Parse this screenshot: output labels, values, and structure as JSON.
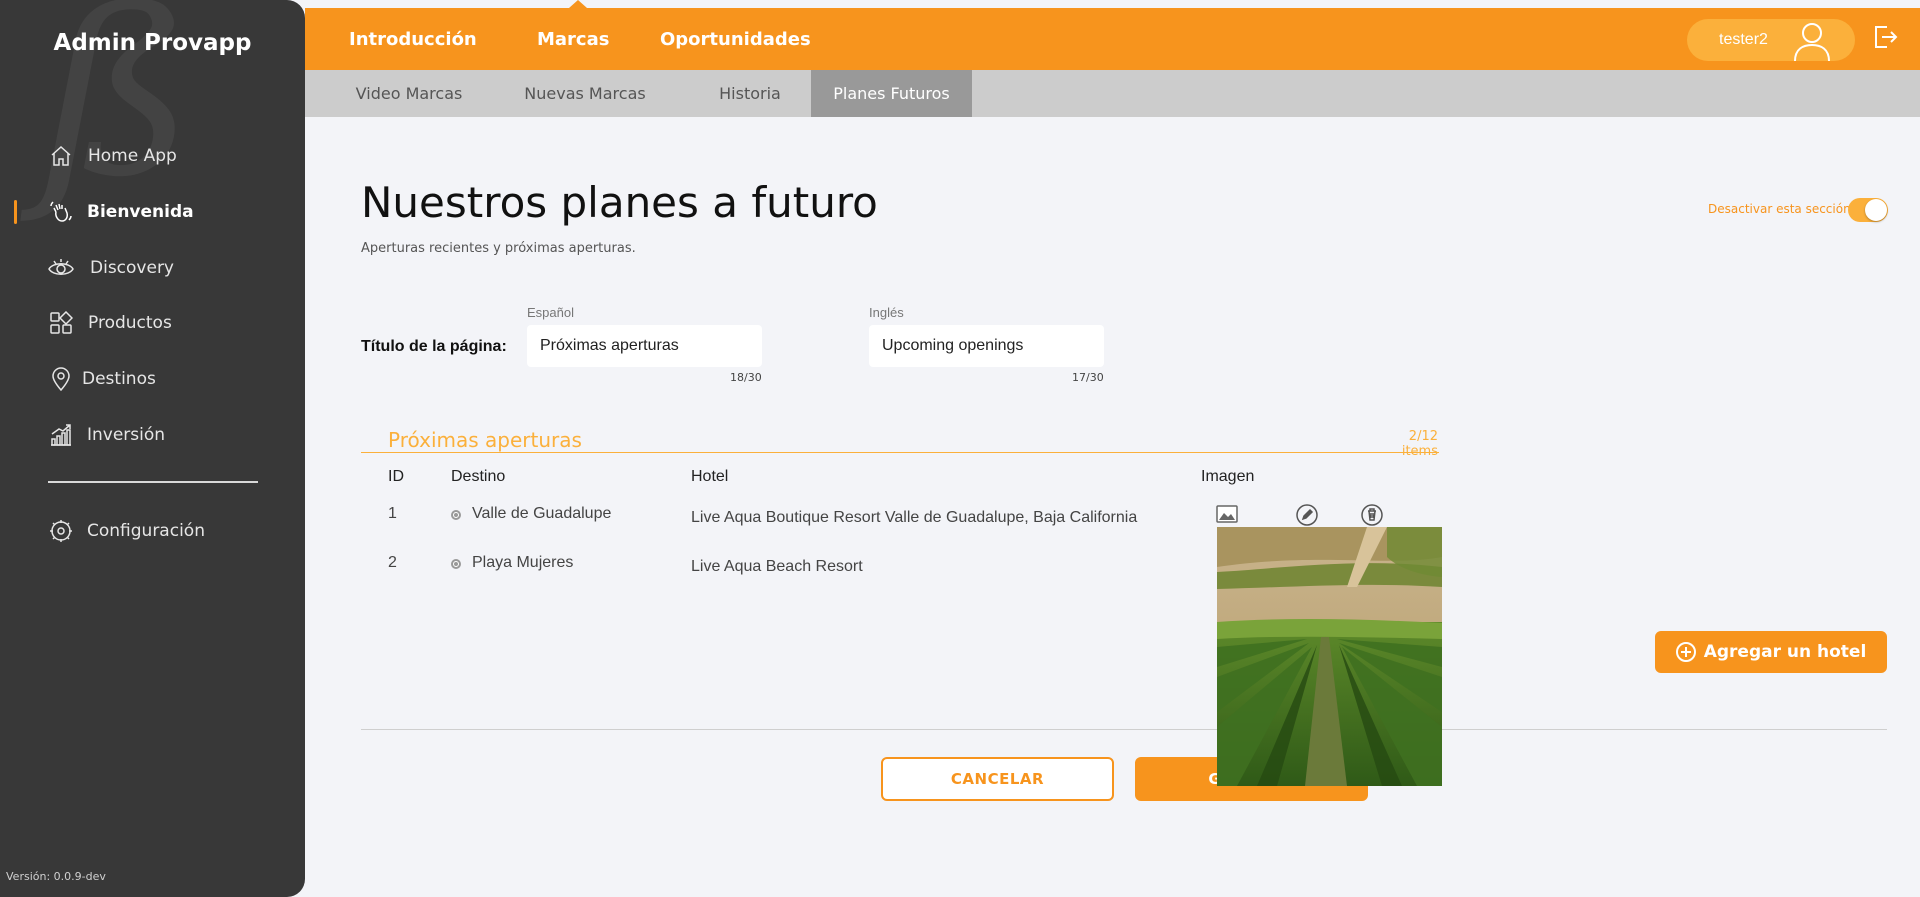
{
  "app": {
    "brand": "Admin Provapp",
    "version": "Versión: 0.0.9-dev"
  },
  "sidebar": {
    "items": [
      {
        "label": "Home App",
        "icon": "home-icon"
      },
      {
        "label": "Bienvenida",
        "icon": "waving-hand-icon",
        "active": true
      },
      {
        "label": "Discovery",
        "icon": "eye-icon"
      },
      {
        "label": "Productos",
        "icon": "grid-shapes-icon"
      },
      {
        "label": "Destinos",
        "icon": "map-pin-icon"
      },
      {
        "label": "Inversión",
        "icon": "growth-chart-icon"
      }
    ],
    "settings": {
      "label": "Configuración",
      "icon": "gear-icon"
    }
  },
  "topnav": {
    "tabs": [
      {
        "label": "Introducción"
      },
      {
        "label": "Marcas",
        "active": true
      },
      {
        "label": "Oportunidades"
      }
    ],
    "user": "tester2"
  },
  "subnav": {
    "tabs": [
      {
        "label": "Video Marcas"
      },
      {
        "label": "Nuevas Marcas"
      },
      {
        "label": "Historia"
      },
      {
        "label": "Planes Futuros",
        "active": true
      }
    ]
  },
  "page": {
    "title": "Nuestros planes a futuro",
    "subtitle": "Aperturas recientes y próximas aperturas.",
    "toggle_label": "Desactivar esta sección",
    "toggle_on": true
  },
  "form": {
    "field_label": "Título de la página:",
    "spanish": {
      "label": "Español",
      "value": "Próximas aperturas",
      "counter": "18/30"
    },
    "english": {
      "label": "Inglés",
      "value": "Upcoming openings",
      "counter": "17/30"
    }
  },
  "section": {
    "title": "Próximas aperturas",
    "count": "2/12 items",
    "columns": {
      "id": "ID",
      "destino": "Destino",
      "hotel": "Hotel",
      "imagen": "Imagen"
    },
    "rows": [
      {
        "id": "1",
        "destino": "Valle de Guadalupe",
        "hotel": "Live Aqua Boutique Resort Valle de Guadalupe, Baja California"
      },
      {
        "id": "2",
        "destino": "Playa Mujeres",
        "hotel": "Live Aqua Beach Resort"
      }
    ],
    "add_label": "Agregar un hotel"
  },
  "actions": {
    "cancel": "CANCELAR",
    "save": "GUARDAR"
  },
  "colors": {
    "accent": "#f7941d",
    "accent_light": "#fbb03b",
    "sidebar": "#383838",
    "subnav": "#cccccc",
    "subnav_active": "#999999"
  }
}
